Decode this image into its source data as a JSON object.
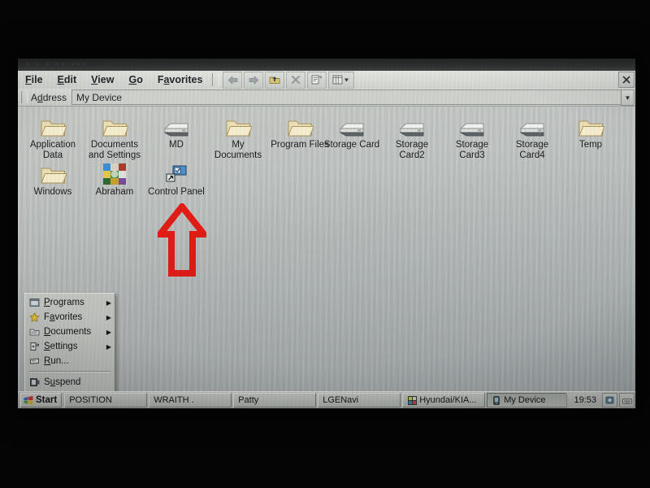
{
  "window": {
    "title": "My Device",
    "close_label": "×"
  },
  "menubar": {
    "items": [
      {
        "label": "File",
        "accel": "F"
      },
      {
        "label": "Edit",
        "accel": "E"
      },
      {
        "label": "View",
        "accel": "V"
      },
      {
        "label": "Go",
        "accel": "G"
      },
      {
        "label": "Favorites",
        "accel": "a"
      }
    ]
  },
  "toolbar": {
    "buttons": [
      {
        "name": "back-button",
        "icon": "arrow-left-icon"
      },
      {
        "name": "forward-button",
        "icon": "arrow-right-icon"
      },
      {
        "name": "up-one-level-button",
        "icon": "up-folder-icon"
      },
      {
        "name": "close-button",
        "icon": "x-icon"
      },
      {
        "name": "properties-button",
        "icon": "properties-icon"
      },
      {
        "name": "view-button",
        "icon": "view-list-icon"
      }
    ]
  },
  "addressbar": {
    "label": "Address",
    "accel": "d",
    "value": "My Device",
    "placeholder": "My Device",
    "dropdown_glyph": "▼"
  },
  "desktop": {
    "icons": [
      {
        "label": "Application Data",
        "type": "folder"
      },
      {
        "label": "Documents and Settings",
        "type": "folder"
      },
      {
        "label": "MD",
        "type": "drive"
      },
      {
        "label": "My Documents",
        "type": "folder"
      },
      {
        "label": "Program Files",
        "type": "folder"
      },
      {
        "label": "Storage Card",
        "type": "drive"
      },
      {
        "label": "Storage Card2",
        "type": "drive"
      },
      {
        "label": "Storage Card3",
        "type": "drive"
      },
      {
        "label": "Storage Card4",
        "type": "drive"
      },
      {
        "label": "Temp",
        "type": "folder"
      },
      {
        "label": "Windows",
        "type": "folder"
      },
      {
        "label": "Abraham",
        "type": "app"
      },
      {
        "label": "Control Panel",
        "type": "control-panel"
      }
    ]
  },
  "startmenu": {
    "items": [
      {
        "label": "Programs",
        "accel": "P",
        "icon": "programs-icon",
        "submenu": true,
        "arrow": "▶"
      },
      {
        "label": "Favorites",
        "accel": "a",
        "icon": "star-icon",
        "submenu": true,
        "arrow": "▶"
      },
      {
        "label": "Documents",
        "accel": "D",
        "icon": "documents-icon",
        "submenu": true,
        "arrow": "▶"
      },
      {
        "label": "Settings",
        "accel": "S",
        "icon": "settings-icon",
        "submenu": true,
        "arrow": "▶"
      },
      {
        "label": "Run...",
        "accel": "R",
        "icon": "run-icon",
        "submenu": false,
        "arrow": ""
      },
      {
        "label": "Suspend",
        "accel": "u",
        "icon": "suspend-icon",
        "submenu": false,
        "arrow": ""
      }
    ]
  },
  "taskbar": {
    "start_label": "Start",
    "buttons": [
      {
        "label": "POSITION",
        "active": false,
        "icon": ""
      },
      {
        "label": "WRAITH  .",
        "active": false,
        "icon": ""
      },
      {
        "label": "Patty",
        "active": false,
        "icon": ""
      },
      {
        "label": "LGENavi",
        "active": false,
        "icon": ""
      },
      {
        "label": "Hyundai/KIA...",
        "active": false,
        "icon": "hyundai-kia-icon"
      },
      {
        "label": "My Device",
        "active": true,
        "icon": "device-icon"
      }
    ],
    "clock": "19:53",
    "tray_icons": [
      "network-icon",
      "keyboard-icon"
    ]
  },
  "annotation": {
    "arrow_color": "#e81d17",
    "points_at": "Control Panel"
  },
  "colors": {
    "screen_bg": "#c2c6c4",
    "chrome": "#cfd2cd",
    "text": "#14161a",
    "folder": "#e8dcb0",
    "accent_red": "#e81d17"
  }
}
